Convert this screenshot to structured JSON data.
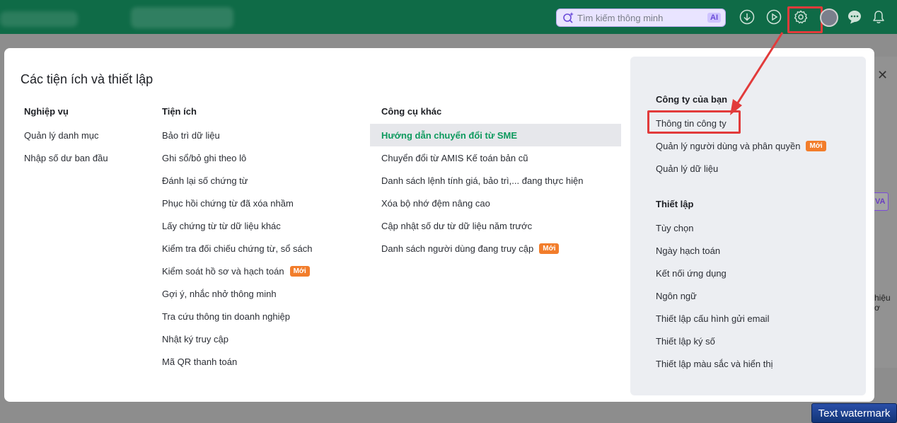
{
  "topbar": {
    "search_placeholder": "Tìm kiếm thông minh",
    "ai_badge": "AI"
  },
  "modal": {
    "title": "Các tiện ích và thiết lập",
    "columns": [
      {
        "heading": "Nghiệp vụ",
        "items": [
          {
            "label": "Quản lý danh mục"
          },
          {
            "label": "Nhập số dư ban đầu"
          }
        ]
      },
      {
        "heading": "Tiện ích",
        "items": [
          {
            "label": "Bảo trì dữ liệu"
          },
          {
            "label": "Ghi sổ/bỏ ghi theo lô"
          },
          {
            "label": "Đánh lại số chứng từ"
          },
          {
            "label": "Phục hồi chứng từ đã xóa nhầm"
          },
          {
            "label": "Lấy chứng từ từ dữ liệu khác"
          },
          {
            "label": "Kiểm tra đối chiếu chứng từ, sổ sách"
          },
          {
            "label": "Kiểm soát hồ sơ và hạch toán",
            "badge": "Mới"
          },
          {
            "label": "Gợi ý, nhắc nhở thông minh"
          },
          {
            "label": "Tra cứu thông tin doanh nghiệp"
          },
          {
            "label": "Nhật ký truy cập"
          },
          {
            "label": "Mã QR thanh toán"
          }
        ]
      },
      {
        "heading": "Công cụ khác",
        "items": [
          {
            "label": "Hướng dẫn chuyển đổi từ SME",
            "active": true
          },
          {
            "label": "Chuyển đổi từ AMIS Kế toán bản cũ"
          },
          {
            "label": "Danh sách lệnh tính giá, bảo trì,... đang thực hiện"
          },
          {
            "label": "Xóa bộ nhớ đệm nâng cao"
          },
          {
            "label": "Cập nhật số dư từ dữ liệu năm trước"
          },
          {
            "label": "Danh sách người dùng đang truy cập",
            "badge": "Mới"
          }
        ]
      }
    ],
    "panel": {
      "company_heading": "Công ty của bạn",
      "company_items": [
        {
          "label": "Thông tin công ty"
        },
        {
          "label": "Quản lý người dùng và phân quyền",
          "badge": "Mới"
        },
        {
          "label": "Quản lý dữ liệu"
        }
      ],
      "settings_heading": "Thiết lập",
      "settings_items": [
        {
          "label": "Tùy chọn"
        },
        {
          "label": "Ngày hạch toán"
        },
        {
          "label": "Kết nối ứng dụng"
        },
        {
          "label": "Ngôn ngữ"
        },
        {
          "label": "Thiết lập cấu hình gửi email"
        },
        {
          "label": "Thiết lập ký số"
        },
        {
          "label": "Thiết lập màu sắc và hiển thị"
        }
      ]
    }
  },
  "background": {
    "va_label": "VA",
    "side_text": "hiệu ơ"
  },
  "watermark": "Text watermark",
  "colors": {
    "topbar": "#0f6b47",
    "active_text": "#0d9a5e",
    "badge": "#f27d2b",
    "highlight": "#e23b3b"
  }
}
